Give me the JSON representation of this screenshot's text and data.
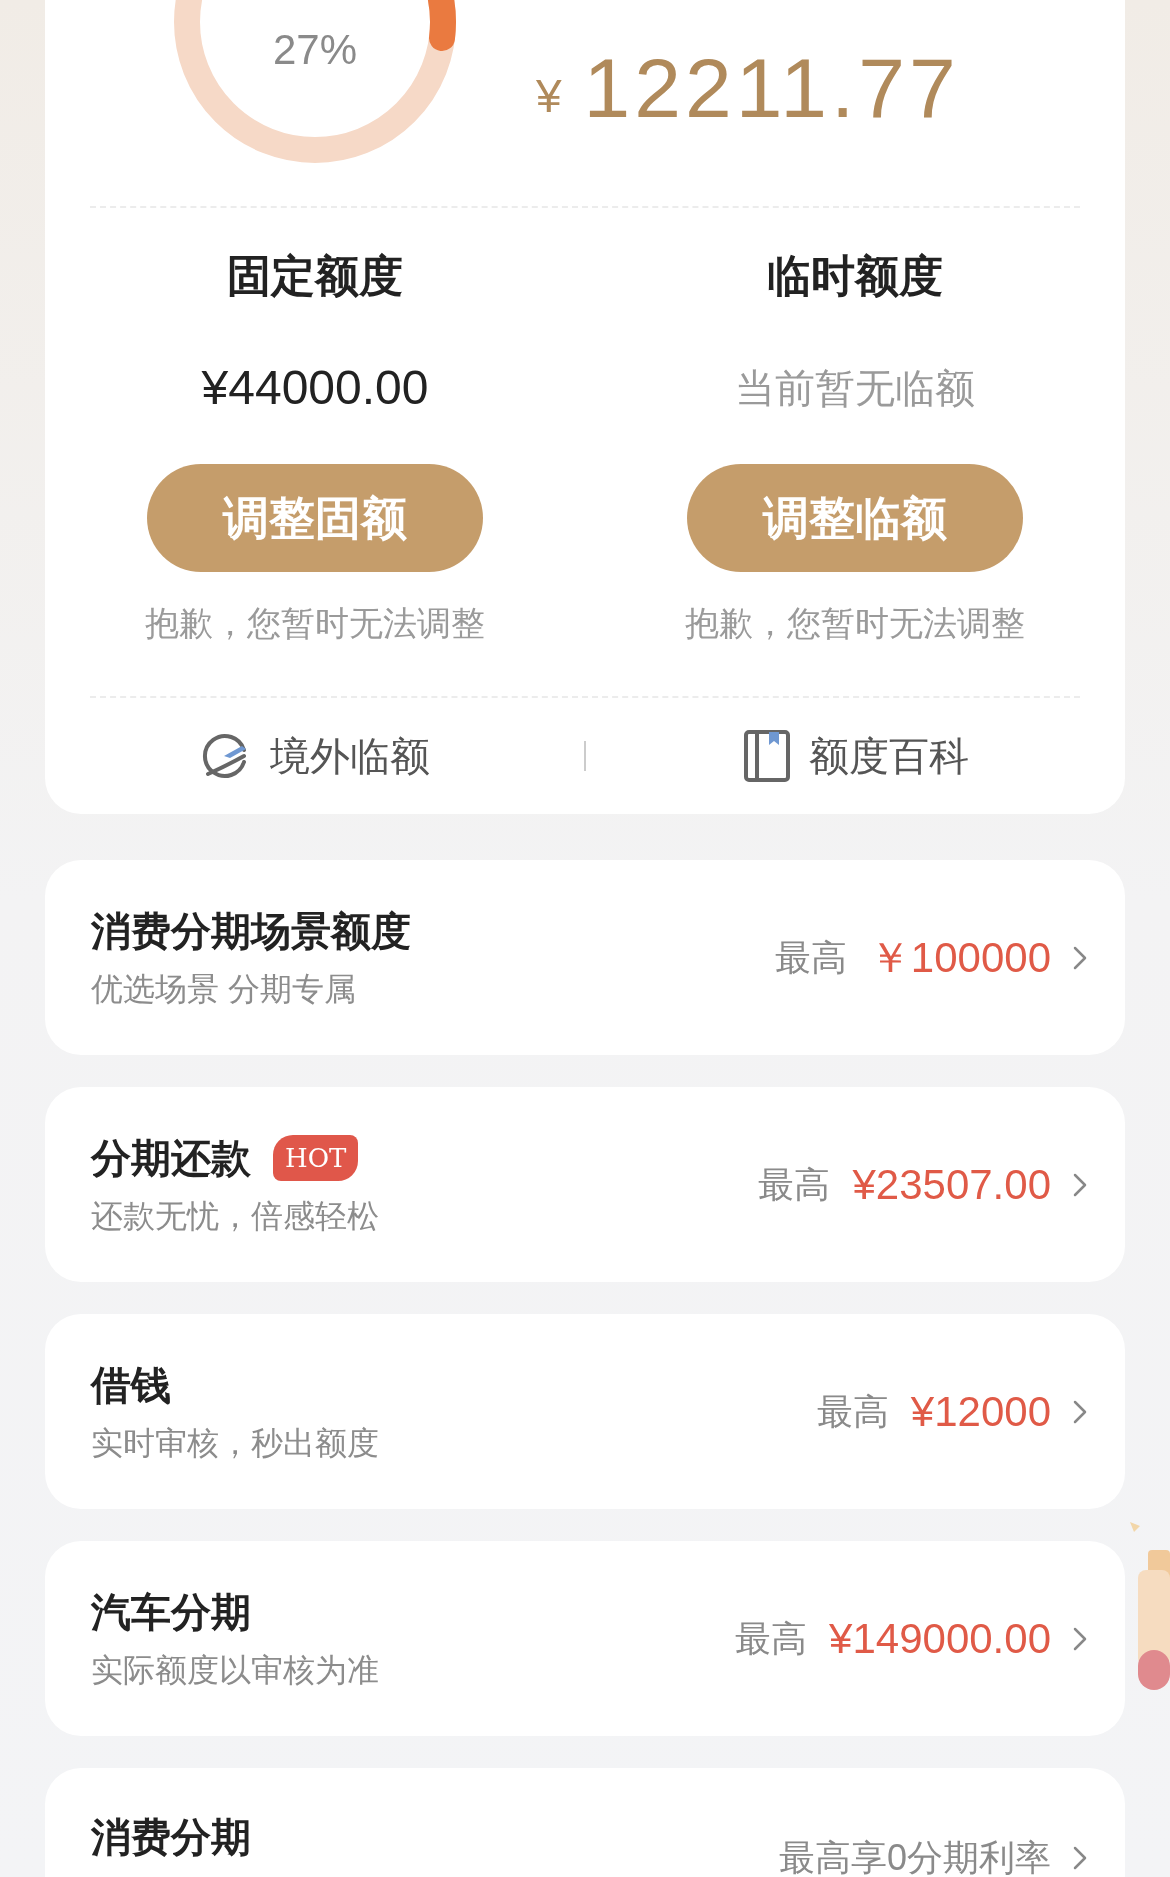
{
  "quota_ring": {
    "percent": "27%"
  },
  "available": {
    "currency": "¥",
    "amount": "12211.77"
  },
  "limits": [
    {
      "title": "固定额度",
      "value": "¥44000.00",
      "greyed": false,
      "button": "调整固额",
      "note": "抱歉，您暂时无法调整"
    },
    {
      "title": "临时额度",
      "value": "当前暂无临额",
      "greyed": true,
      "button": "调整临额",
      "note": "抱歉，您暂时无法调整"
    }
  ],
  "links": [
    {
      "label": "境外临额"
    },
    {
      "label": "额度百科"
    }
  ],
  "products": [
    {
      "title": "消费分期场景额度",
      "subtitle": "优选场景 分期专属",
      "prefix": "最高",
      "amount": "￥100000"
    },
    {
      "title": "分期还款",
      "badge": "HOT",
      "subtitle": "还款无忧，倍感轻松",
      "prefix": "最高",
      "amount": "¥23507.00"
    },
    {
      "title": "借钱",
      "subtitle": "实时审核，秒出额度",
      "prefix": "最高",
      "amount": "¥12000"
    },
    {
      "title": "汽车分期",
      "subtitle": "实际额度以审核为准",
      "prefix": "最高",
      "amount": "¥149000.00"
    },
    {
      "title": "消费分期",
      "prefix": "最高享0分期利率"
    }
  ]
}
